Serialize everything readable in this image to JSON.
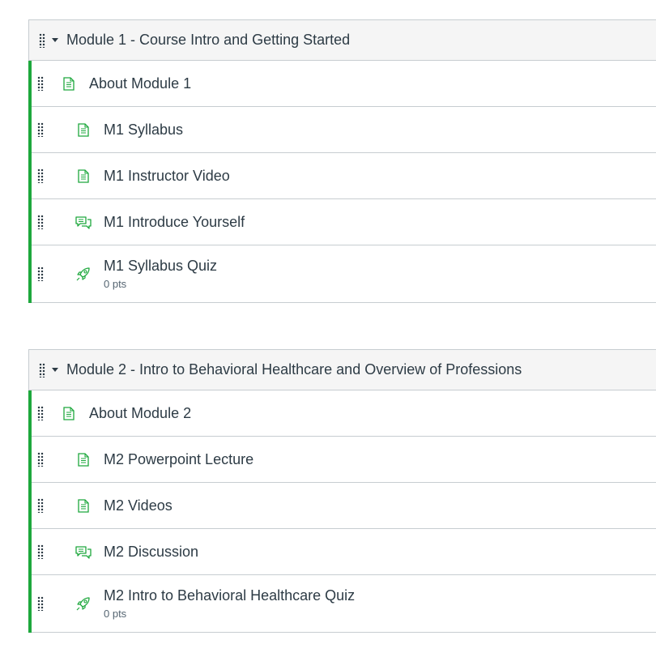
{
  "colors": {
    "accent": "#1ea83d",
    "text": "#2d3b45",
    "border": "#c7cdd1",
    "header_bg": "#f5f5f5"
  },
  "modules": [
    {
      "title": "Module 1 - Course Intro and Getting Started",
      "items": [
        {
          "icon": "page-icon",
          "title": "About Module 1",
          "indent": 0
        },
        {
          "icon": "page-icon",
          "title": "M1 Syllabus",
          "indent": 1
        },
        {
          "icon": "page-icon",
          "title": "M1 Instructor Video",
          "indent": 1
        },
        {
          "icon": "discussion-icon",
          "title": "M1 Introduce Yourself",
          "indent": 1
        },
        {
          "icon": "quiz-icon",
          "title": "M1 Syllabus Quiz",
          "indent": 1,
          "points": "0 pts"
        }
      ]
    },
    {
      "title": "Module 2 - Intro to Behavioral Healthcare and Overview of Professions",
      "items": [
        {
          "icon": "page-icon",
          "title": "About Module 2",
          "indent": 0
        },
        {
          "icon": "page-icon",
          "title": "M2 Powerpoint Lecture",
          "indent": 1
        },
        {
          "icon": "page-icon",
          "title": "M2 Videos",
          "indent": 1
        },
        {
          "icon": "discussion-icon",
          "title": "M2 Discussion",
          "indent": 1
        },
        {
          "icon": "quiz-icon",
          "title": "M2 Intro to Behavioral Healthcare Quiz",
          "indent": 1,
          "points": "0 pts"
        }
      ]
    }
  ]
}
